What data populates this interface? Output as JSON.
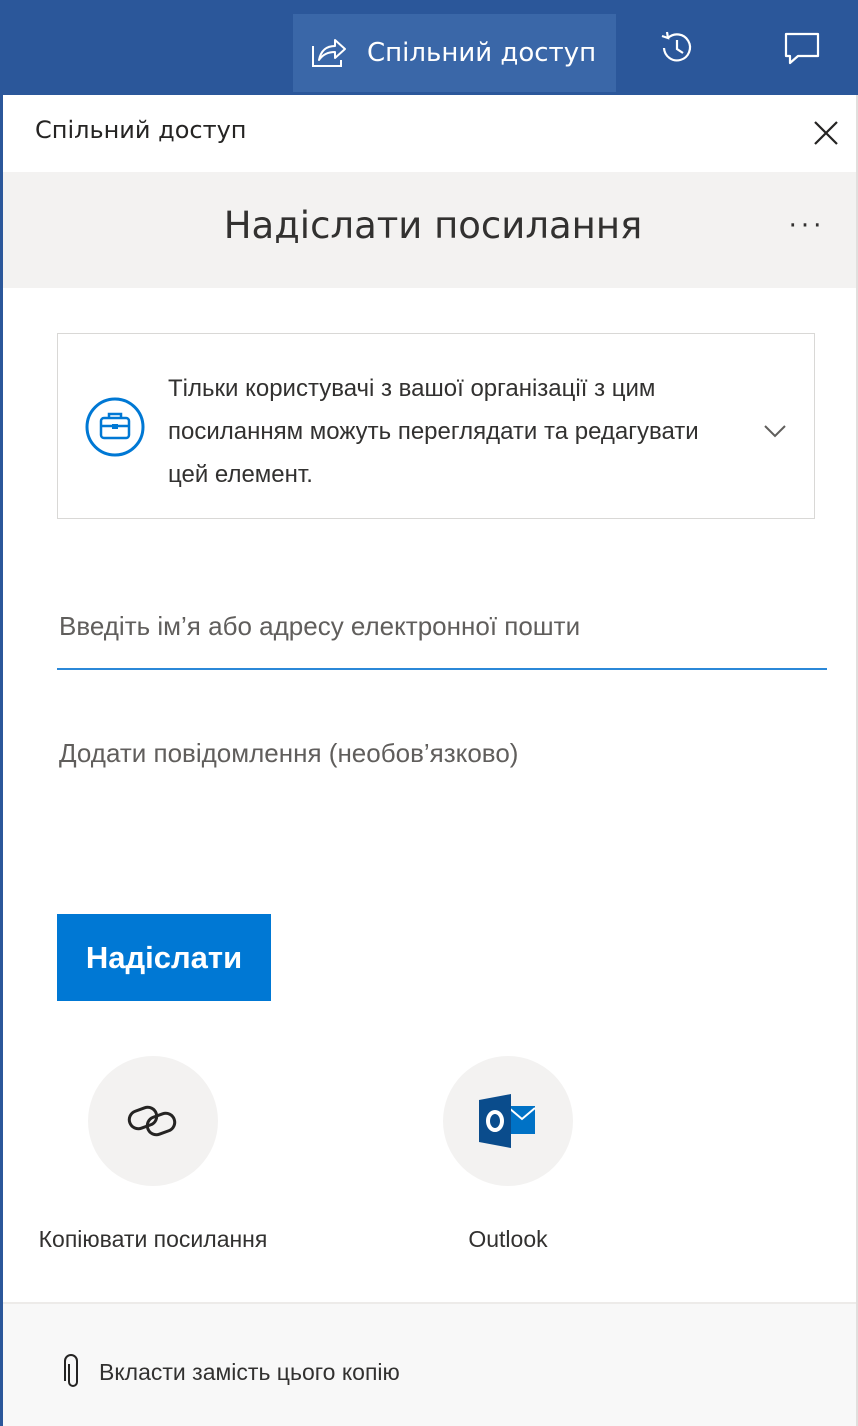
{
  "ribbon": {
    "share_label": "Спільний доступ",
    "history_icon": "history-icon",
    "comments_icon": "comment-icon"
  },
  "panel": {
    "title": "Спільний доступ",
    "heading": "Надіслати посилання",
    "more": "···"
  },
  "permission": {
    "text": "Тільки користувачі з вашої організації з цим посиланням можуть переглядати та редагувати цей елемент.",
    "icon": "briefcase-icon"
  },
  "recipients": {
    "placeholder": "Введіть ім’я або адресу електронної пошти",
    "value": ""
  },
  "message": {
    "placeholder": "Додати повідомлення (необов’язково)",
    "value": ""
  },
  "send_label": "Надіслати",
  "options": [
    {
      "label": "Копіювати посилання",
      "icon": "link-icon"
    },
    {
      "label": "Outlook",
      "icon": "outlook-icon"
    }
  ],
  "attach_label": "Вкласти замість цього копію",
  "colors": {
    "ribbon": "#2b579a",
    "accent": "#0078d4",
    "outlook": "#0072c6"
  }
}
